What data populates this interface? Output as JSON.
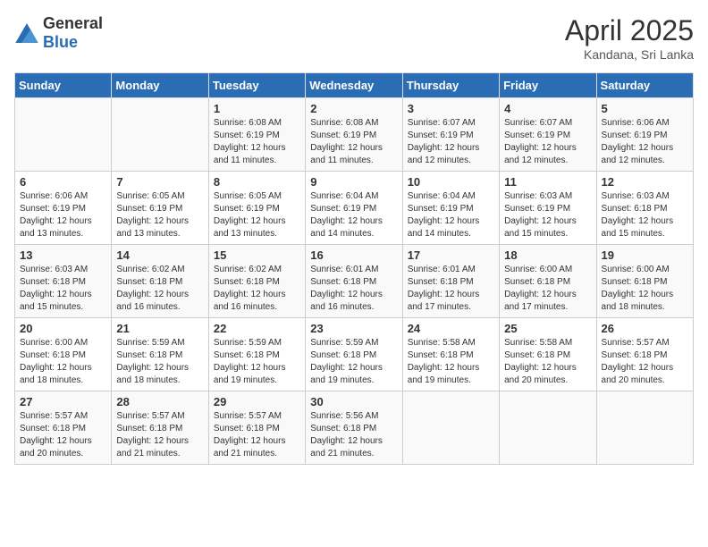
{
  "header": {
    "logo_general": "General",
    "logo_blue": "Blue",
    "title": "April 2025",
    "subtitle": "Kandana, Sri Lanka"
  },
  "days_of_week": [
    "Sunday",
    "Monday",
    "Tuesday",
    "Wednesday",
    "Thursday",
    "Friday",
    "Saturday"
  ],
  "weeks": [
    [
      {
        "day": "",
        "info": ""
      },
      {
        "day": "",
        "info": ""
      },
      {
        "day": "1",
        "info": "Sunrise: 6:08 AM\nSunset: 6:19 PM\nDaylight: 12 hours and 11 minutes."
      },
      {
        "day": "2",
        "info": "Sunrise: 6:08 AM\nSunset: 6:19 PM\nDaylight: 12 hours and 11 minutes."
      },
      {
        "day": "3",
        "info": "Sunrise: 6:07 AM\nSunset: 6:19 PM\nDaylight: 12 hours and 12 minutes."
      },
      {
        "day": "4",
        "info": "Sunrise: 6:07 AM\nSunset: 6:19 PM\nDaylight: 12 hours and 12 minutes."
      },
      {
        "day": "5",
        "info": "Sunrise: 6:06 AM\nSunset: 6:19 PM\nDaylight: 12 hours and 12 minutes."
      }
    ],
    [
      {
        "day": "6",
        "info": "Sunrise: 6:06 AM\nSunset: 6:19 PM\nDaylight: 12 hours and 13 minutes."
      },
      {
        "day": "7",
        "info": "Sunrise: 6:05 AM\nSunset: 6:19 PM\nDaylight: 12 hours and 13 minutes."
      },
      {
        "day": "8",
        "info": "Sunrise: 6:05 AM\nSunset: 6:19 PM\nDaylight: 12 hours and 13 minutes."
      },
      {
        "day": "9",
        "info": "Sunrise: 6:04 AM\nSunset: 6:19 PM\nDaylight: 12 hours and 14 minutes."
      },
      {
        "day": "10",
        "info": "Sunrise: 6:04 AM\nSunset: 6:19 PM\nDaylight: 12 hours and 14 minutes."
      },
      {
        "day": "11",
        "info": "Sunrise: 6:03 AM\nSunset: 6:19 PM\nDaylight: 12 hours and 15 minutes."
      },
      {
        "day": "12",
        "info": "Sunrise: 6:03 AM\nSunset: 6:18 PM\nDaylight: 12 hours and 15 minutes."
      }
    ],
    [
      {
        "day": "13",
        "info": "Sunrise: 6:03 AM\nSunset: 6:18 PM\nDaylight: 12 hours and 15 minutes."
      },
      {
        "day": "14",
        "info": "Sunrise: 6:02 AM\nSunset: 6:18 PM\nDaylight: 12 hours and 16 minutes."
      },
      {
        "day": "15",
        "info": "Sunrise: 6:02 AM\nSunset: 6:18 PM\nDaylight: 12 hours and 16 minutes."
      },
      {
        "day": "16",
        "info": "Sunrise: 6:01 AM\nSunset: 6:18 PM\nDaylight: 12 hours and 16 minutes."
      },
      {
        "day": "17",
        "info": "Sunrise: 6:01 AM\nSunset: 6:18 PM\nDaylight: 12 hours and 17 minutes."
      },
      {
        "day": "18",
        "info": "Sunrise: 6:00 AM\nSunset: 6:18 PM\nDaylight: 12 hours and 17 minutes."
      },
      {
        "day": "19",
        "info": "Sunrise: 6:00 AM\nSunset: 6:18 PM\nDaylight: 12 hours and 18 minutes."
      }
    ],
    [
      {
        "day": "20",
        "info": "Sunrise: 6:00 AM\nSunset: 6:18 PM\nDaylight: 12 hours and 18 minutes."
      },
      {
        "day": "21",
        "info": "Sunrise: 5:59 AM\nSunset: 6:18 PM\nDaylight: 12 hours and 18 minutes."
      },
      {
        "day": "22",
        "info": "Sunrise: 5:59 AM\nSunset: 6:18 PM\nDaylight: 12 hours and 19 minutes."
      },
      {
        "day": "23",
        "info": "Sunrise: 5:59 AM\nSunset: 6:18 PM\nDaylight: 12 hours and 19 minutes."
      },
      {
        "day": "24",
        "info": "Sunrise: 5:58 AM\nSunset: 6:18 PM\nDaylight: 12 hours and 19 minutes."
      },
      {
        "day": "25",
        "info": "Sunrise: 5:58 AM\nSunset: 6:18 PM\nDaylight: 12 hours and 20 minutes."
      },
      {
        "day": "26",
        "info": "Sunrise: 5:57 AM\nSunset: 6:18 PM\nDaylight: 12 hours and 20 minutes."
      }
    ],
    [
      {
        "day": "27",
        "info": "Sunrise: 5:57 AM\nSunset: 6:18 PM\nDaylight: 12 hours and 20 minutes."
      },
      {
        "day": "28",
        "info": "Sunrise: 5:57 AM\nSunset: 6:18 PM\nDaylight: 12 hours and 21 minutes."
      },
      {
        "day": "29",
        "info": "Sunrise: 5:57 AM\nSunset: 6:18 PM\nDaylight: 12 hours and 21 minutes."
      },
      {
        "day": "30",
        "info": "Sunrise: 5:56 AM\nSunset: 6:18 PM\nDaylight: 12 hours and 21 minutes."
      },
      {
        "day": "",
        "info": ""
      },
      {
        "day": "",
        "info": ""
      },
      {
        "day": "",
        "info": ""
      }
    ]
  ]
}
